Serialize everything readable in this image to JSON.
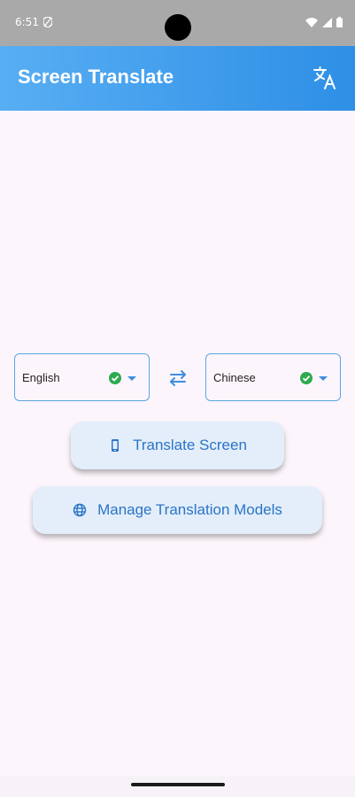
{
  "status": {
    "time": "6:51"
  },
  "app": {
    "title": "Screen Translate"
  },
  "languages": {
    "source": "English",
    "target": "Chinese"
  },
  "buttons": {
    "translate_screen": "Translate Screen",
    "manage_models": "Manage Translation Models"
  },
  "colors": {
    "accent": "#2e8fe6",
    "button_bg": "#e3eefa",
    "button_text": "#2b74c7",
    "check": "#2eaa4f"
  },
  "icons": {
    "app_bar": "translate-icon",
    "swap": "swap-icon",
    "phone": "phone-icon",
    "globe": "globe-icon"
  }
}
